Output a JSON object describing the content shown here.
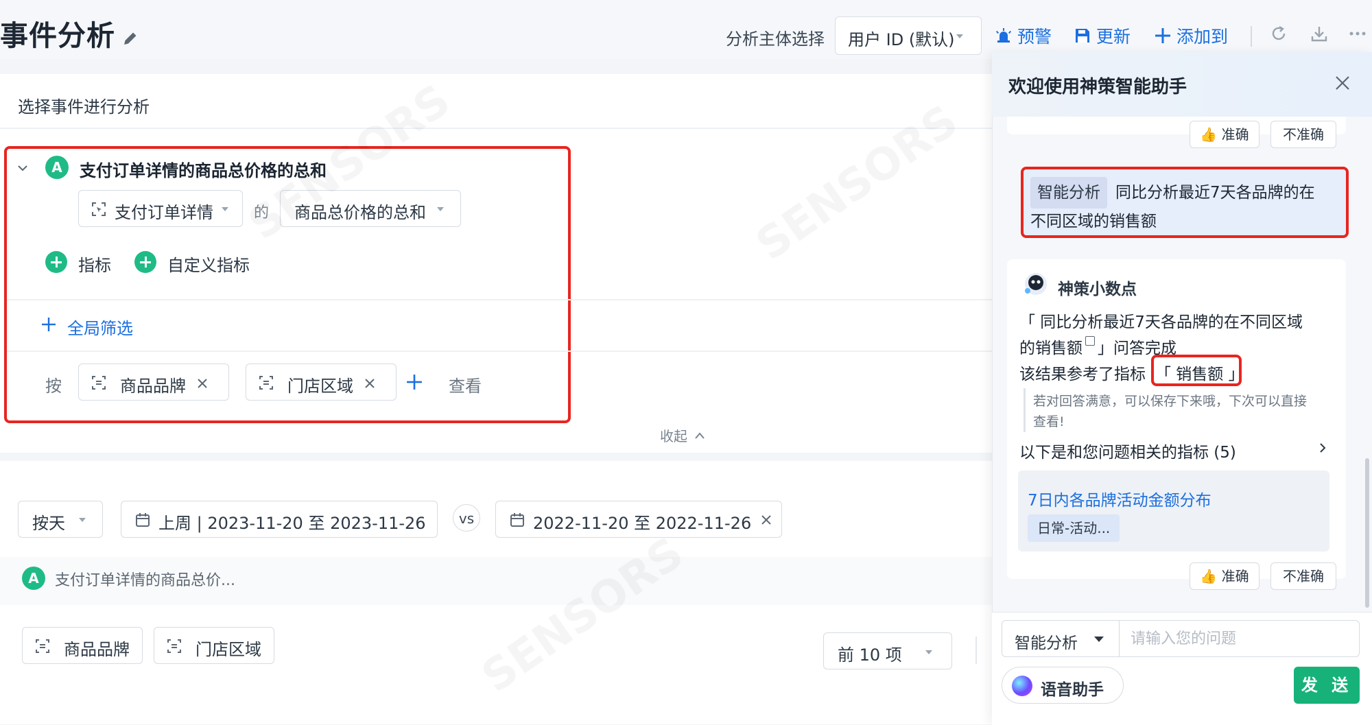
{
  "header": {
    "title": "事件分析",
    "subject_label": "分析主体选择",
    "subject_value": "用户 ID (默认)",
    "alert_label": "预警",
    "update_label": "更新",
    "add_to_label": "添加到"
  },
  "query": {
    "heading": "选择事件进行分析",
    "metric_badge": "A",
    "metric_title": "支付订单详情的商品总价格的总和",
    "event_select": "支付订单详情",
    "de_label": "的",
    "aggregation_select": "商品总价格的总和",
    "add_metric_label": "指标",
    "add_custom_metric_label": "自定义指标",
    "global_filter_label": "全局筛选",
    "by_label": "按",
    "group_by": [
      "商品品牌",
      "门店区域"
    ],
    "view_label": "查看",
    "collapse_label": "收起"
  },
  "time": {
    "granularity": "按天",
    "range": "上周 | 2023-11-20 至 2023-11-26",
    "vs_label": "vs",
    "compare_range": "2022-11-20 至 2022-11-26",
    "legend_badge": "A",
    "legend_text": "支付订单详情的商品总价...",
    "dim_chips": [
      "商品品牌",
      "门店区域"
    ],
    "topn": "前 10 项"
  },
  "assistant": {
    "title": "欢迎使用神策智能助手",
    "accurate_label": "准确",
    "inaccurate_label": "不准确",
    "user_tag": "智能分析",
    "user_question_line1": "同比分析最近7天各品牌的在",
    "user_question_line2": "不同区域的销售额",
    "bot_name": "神策小数点",
    "answer_line1": "「 同比分析最近7天各品牌的在不同区域",
    "answer_line2a": "的销售额",
    "answer_line2b": "」问答完成",
    "answer_line3": "该结果参考了指标",
    "metric_ref": "「 销售额 」",
    "tip_line1": "若对回答满意，可以保存下来哦，下次可以直接",
    "tip_line2": "查看!",
    "related_label": "以下是和您问题相关的指标 (5)",
    "related_title": "7日内各品牌活动金额分布",
    "related_tag": "日常-活动...",
    "mode_select": "智能分析",
    "input_placeholder": "请输入您的问题",
    "voice_label": "语音助手",
    "send_label": "发 送"
  },
  "colors": {
    "accent_blue": "#1b6fe0",
    "brand_green": "#1fbb86",
    "highlight_red": "#e8251f",
    "send_green": "#16b27a"
  }
}
